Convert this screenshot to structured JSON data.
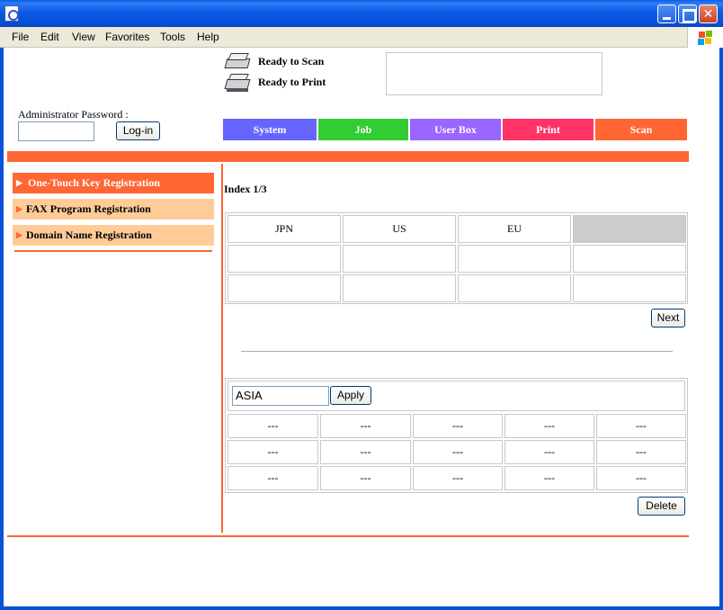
{
  "window": {
    "controls": {
      "minimize_icon": "minimize-icon",
      "maximize_icon": "maximize-icon",
      "close_icon": "close-icon"
    }
  },
  "menubar": {
    "items": [
      "File",
      "Edit",
      "View",
      "Favorites",
      "Tools",
      "Help"
    ]
  },
  "status": {
    "scan_label": "Ready to Scan",
    "print_label": "Ready to Print",
    "message": ""
  },
  "admin": {
    "password_label": "Administrator Password :",
    "password_value": "",
    "login_label": "Log-in"
  },
  "tabs": [
    {
      "label": "System",
      "color": "#6666ff"
    },
    {
      "label": "Job",
      "color": "#33cc33"
    },
    {
      "label": "User Box",
      "color": "#9966ff"
    },
    {
      "label": "Print",
      "color": "#ff3366"
    },
    {
      "label": "Scan",
      "color": "#ff6633"
    }
  ],
  "sidebar": {
    "items": [
      {
        "label": "One-Touch Key Registration",
        "active": true
      },
      {
        "label": "FAX Program Registration",
        "active": false
      },
      {
        "label": "Domain Name Registration",
        "active": false
      }
    ]
  },
  "index": {
    "label": "Index 1/3",
    "rows": [
      [
        "JPN",
        "US",
        "EU",
        ""
      ],
      [
        "",
        "",
        "",
        ""
      ],
      [
        "",
        "",
        "",
        ""
      ]
    ],
    "next_label": "Next"
  },
  "domain": {
    "input_value": "ASIA",
    "apply_label": "Apply",
    "rows": [
      [
        "---",
        "---",
        "---",
        "---",
        "---"
      ],
      [
        "---",
        "---",
        "---",
        "---",
        "---"
      ],
      [
        "---",
        "---",
        "---",
        "---",
        "---"
      ]
    ],
    "delete_label": "Delete"
  },
  "colors": {
    "accent": "#ff6633",
    "sidebar_inactive": "#ffcc99",
    "titlebar": "#0b5ae6"
  }
}
